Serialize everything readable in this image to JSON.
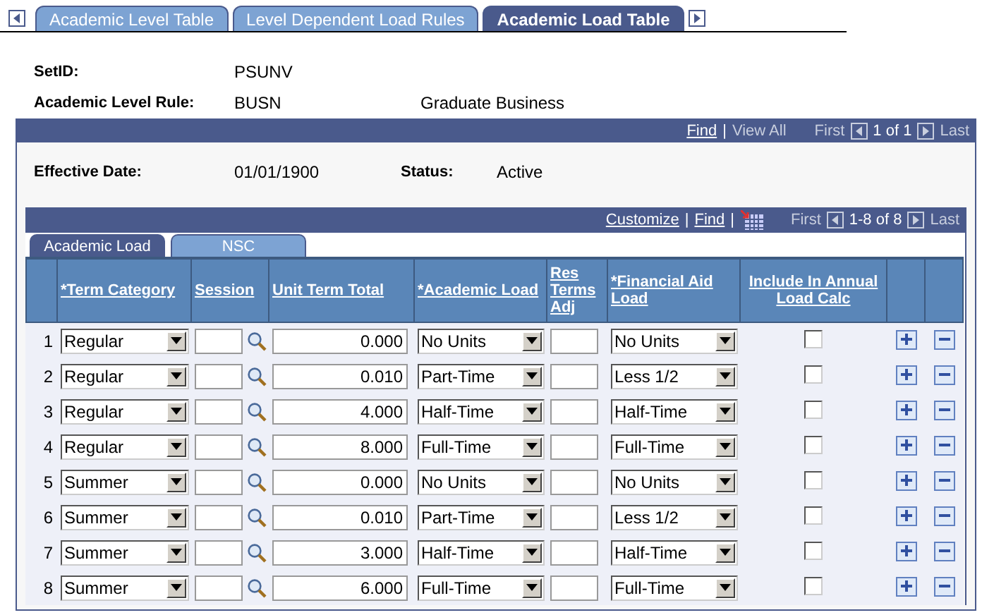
{
  "page_tabs": [
    {
      "label": "Academic Level Table",
      "selected": false
    },
    {
      "label": "Level Dependent Load Rules",
      "selected": false
    },
    {
      "label": "Academic Load Table",
      "selected": true
    }
  ],
  "fields": [
    {
      "label": "SetID:",
      "value": "PSUNV"
    },
    {
      "label": "Academic Level Rule:",
      "value": "BUSN",
      "description": "Graduate Business"
    }
  ],
  "nav": {
    "find": "Find",
    "separator": "|",
    "view_all": "View All",
    "first": "First",
    "counter": "1 of 1",
    "last": "Last"
  },
  "effective_date": {
    "label": "Effective Date:",
    "value": "01/01/1900"
  },
  "status": {
    "label": "Status:",
    "value": "Active"
  },
  "grid": {
    "customize": "Customize",
    "separator_1": "|",
    "find": "Find",
    "separator_2": "|",
    "first": "First",
    "counter": "1-8 of 8",
    "last": "Last",
    "tabs": [
      {
        "label": "Academic Load",
        "selected": true
      },
      {
        "label": "NSC",
        "selected": false
      }
    ],
    "columns": [
      "*Term Category",
      "Session",
      "Unit Term Total",
      "*Academic Load",
      "Res Terms Adj",
      "*Financial Aid Load",
      "Include In Annual Load Calc"
    ],
    "rows": [
      {
        "num": "1",
        "term_category": "Regular",
        "unit_term_total": "0.000",
        "academic_load": "No Units",
        "financial_aid_load": "No Units",
        "include": false
      },
      {
        "num": "2",
        "term_category": "Regular",
        "unit_term_total": "0.010",
        "academic_load": "Part-Time",
        "financial_aid_load": "Less 1/2",
        "include": false
      },
      {
        "num": "3",
        "term_category": "Regular",
        "unit_term_total": "4.000",
        "academic_load": "Half-Time",
        "financial_aid_load": "Half-Time",
        "include": false
      },
      {
        "num": "4",
        "term_category": "Regular",
        "unit_term_total": "8.000",
        "academic_load": "Full-Time",
        "financial_aid_load": "Full-Time",
        "include": false
      },
      {
        "num": "5",
        "term_category": "Summer",
        "unit_term_total": "0.000",
        "academic_load": "No Units",
        "financial_aid_load": "No Units",
        "include": false
      },
      {
        "num": "6",
        "term_category": "Summer",
        "unit_term_total": "0.010",
        "academic_load": "Part-Time",
        "financial_aid_load": "Less 1/2",
        "include": false
      },
      {
        "num": "7",
        "term_category": "Summer",
        "unit_term_total": "3.000",
        "academic_load": "Half-Time",
        "financial_aid_load": "Half-Time",
        "include": false
      },
      {
        "num": "8",
        "term_category": "Summer",
        "unit_term_total": "6.000",
        "academic_load": "Full-Time",
        "financial_aid_load": "Full-Time",
        "include": false
      }
    ]
  }
}
